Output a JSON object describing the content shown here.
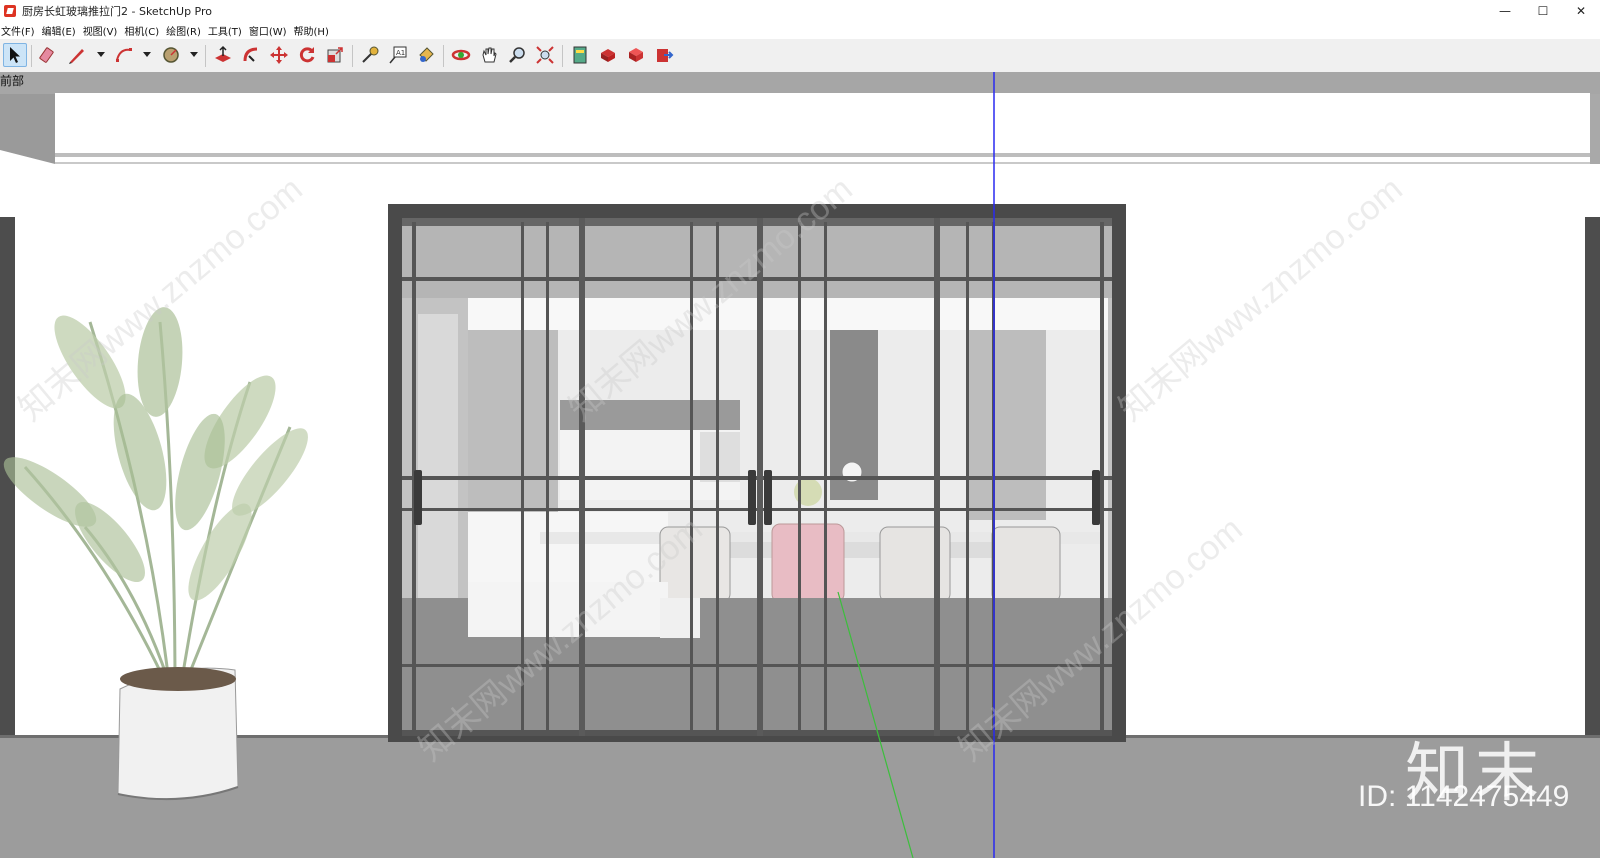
{
  "window": {
    "title": "厨房长虹玻璃推拉门2 - SketchUp Pro",
    "minimize": "—",
    "maximize": "☐",
    "close": "✕"
  },
  "menu": [
    "文件(F)",
    "编辑(E)",
    "视图(V)",
    "相机(C)",
    "绘图(R)",
    "工具(T)",
    "窗口(W)",
    "帮助(H)"
  ],
  "toolbar": {
    "tools": [
      "select-icon",
      "eraser-icon",
      "pencil-icon",
      "arc-icon",
      "paint-bucket-icon",
      "push-pull-icon",
      "follow-me-icon",
      "move-icon",
      "rotate-icon",
      "scale-icon",
      "tape-measure-icon",
      "text-icon",
      "paint-icon",
      "orbit-icon",
      "pan-icon",
      "zoom-icon",
      "zoom-extents-icon",
      "warehouse-icon",
      "extension-icon",
      "components-icon",
      "export-icon"
    ]
  },
  "viewport": {
    "scene_tab": "前部"
  },
  "watermark": {
    "logo": "知末",
    "id_text": "ID: 1142475449",
    "diagonal": "知末网www.znzmo.com"
  },
  "colors": {
    "floor": "#9c9c9c",
    "wall": "#ffffff",
    "frame": "#4a4a4a",
    "glass": "#c8c8c8",
    "blue_axis": "#2a2af0",
    "green_axis": "#3bbf3b"
  }
}
